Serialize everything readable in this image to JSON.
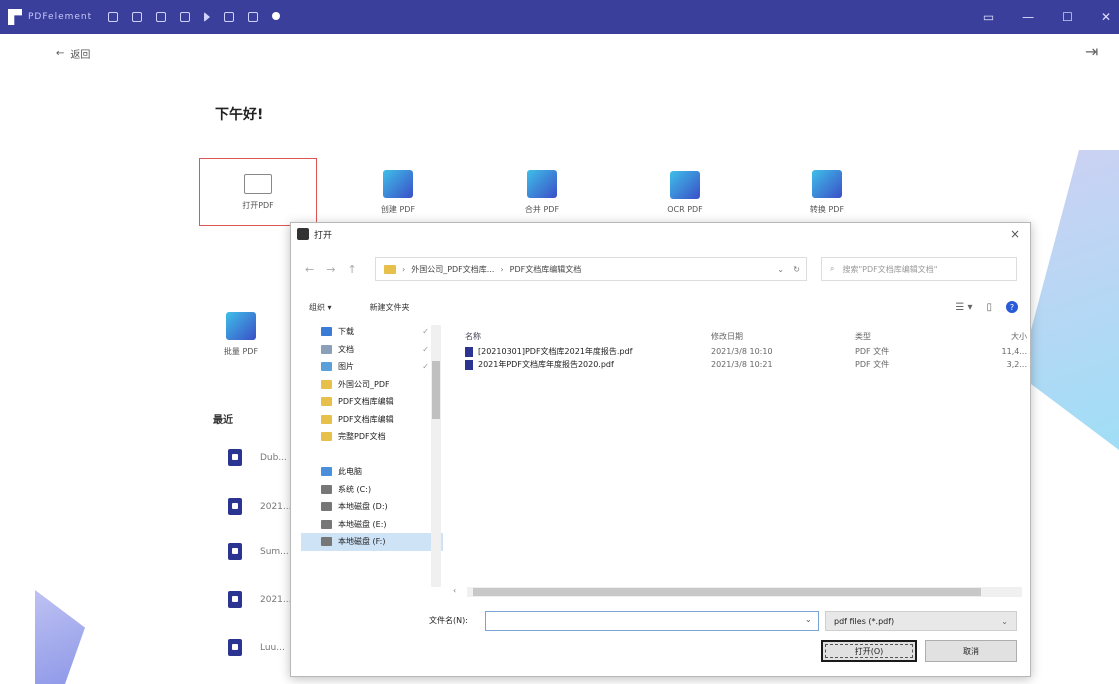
{
  "app": {
    "name": "PDFelement"
  },
  "window_controls": [
    "▭",
    "—",
    "☐",
    "✕"
  ],
  "back": {
    "arrow": "←",
    "label": "返回"
  },
  "greeting": "下午好!",
  "tiles": [
    {
      "label": "打开PDF"
    },
    {
      "label": "创建 PDF"
    },
    {
      "label": "合并 PDF"
    },
    {
      "label": "OCR PDF"
    },
    {
      "label": "转换 PDF"
    },
    {
      "label": "批量 PDF"
    }
  ],
  "recent": {
    "title": "最近",
    "items": [
      "Dub...",
      "2021...",
      "Sum...",
      "2021...",
      "Luu..."
    ]
  },
  "dialog": {
    "title": "打开",
    "close": "×",
    "nav": {
      "back": "←",
      "forward": "→",
      "up": "↑"
    },
    "address": {
      "segments": [
        "外国公司_PDF文档库...",
        "PDF文档库编辑文档"
      ],
      "dropdown": "⌄",
      "refresh": "↻"
    },
    "search_placeholder": "搜索\"PDF文档库编辑文档\"",
    "organize": "组织 ▾",
    "new_folder": "新建文件夹",
    "nav_items": [
      {
        "label": "下载",
        "color": "#3a7bd5",
        "pin": "✓"
      },
      {
        "label": "文档",
        "color": "#8aa0b8",
        "pin": "✓"
      },
      {
        "label": "图片",
        "color": "#5ba0d8",
        "pin": "✓"
      },
      {
        "label": "外国公司_PDF",
        "color": "#e6c04a",
        "pin": ""
      },
      {
        "label": "PDF文档库编辑",
        "color": "#e6c04a",
        "pin": ""
      },
      {
        "label": "PDF文档库编辑",
        "color": "#e6c04a",
        "pin": ""
      },
      {
        "label": "完整PDF文档",
        "color": "#e6c04a",
        "pin": ""
      },
      {
        "label": "",
        "color": "transparent",
        "pin": ""
      },
      {
        "label": "此电脑",
        "color": "#4a8fdc",
        "pin": ""
      },
      {
        "label": "系统 (C:)",
        "color": "#777",
        "pin": ""
      },
      {
        "label": "本地磁盘 (D:)",
        "color": "#777",
        "pin": ""
      },
      {
        "label": "本地磁盘 (E:)",
        "color": "#777",
        "pin": ""
      },
      {
        "label": "本地磁盘 (F:)",
        "color": "#777",
        "pin": ""
      }
    ],
    "columns": {
      "name": "名称",
      "date": "修改日期",
      "type": "类型",
      "size": "大小"
    },
    "files": [
      {
        "name": "[20210301]PDF文档库2021年度报告.pdf",
        "date": "2021/3/8 10:10",
        "type": "PDF 文件",
        "size": "11,4..."
      },
      {
        "name": "2021年PDF文档库年度报告2020.pdf",
        "date": "2021/3/8 10:21",
        "type": "PDF 文件",
        "size": "3,2..."
      }
    ],
    "filename_label": "文件名(N):",
    "filename_value": "",
    "filetype": "pdf files (*.pdf)",
    "open_button": "打开(O)",
    "cancel_button": "取消"
  },
  "colors": {
    "titlebar": "#3b3f9c",
    "accent": "#2b3490"
  }
}
